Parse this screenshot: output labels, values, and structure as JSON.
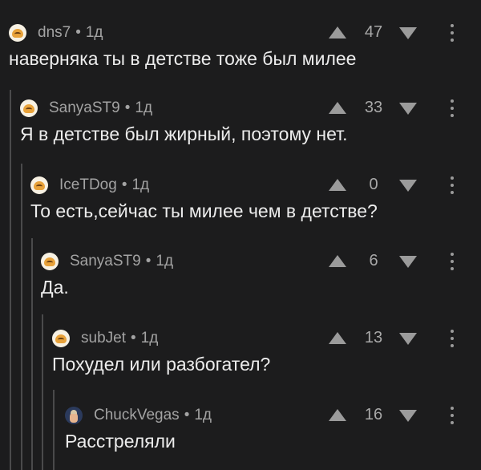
{
  "comments": [
    {
      "username": "dns7",
      "time": "1д",
      "score": "47",
      "text": "наверняка ты в детстве тоже был милее"
    },
    {
      "username": "SanyaST9",
      "time": "1д",
      "score": "33",
      "text": "Я в детстве был жирный, поэтому нет."
    },
    {
      "username": "IceTDog",
      "time": "1д",
      "score": "0",
      "text": "То есть,сейчас ты милее чем в детстве?"
    },
    {
      "username": "SanyaST9",
      "time": "1д",
      "score": "6",
      "text": "Да."
    },
    {
      "username": "subJet",
      "time": "1д",
      "score": "13",
      "text": "Похудел или разбогател?"
    },
    {
      "username": "ChuckVegas",
      "time": "1д",
      "score": "16",
      "text": "Расстреляли"
    }
  ],
  "separator": "•",
  "icons": {
    "upvote": "arrow-up-icon",
    "downvote": "arrow-down-icon",
    "more": "more-vertical-icon"
  },
  "colors": {
    "background": "#1c1c1d",
    "text": "#ececec",
    "muted": "#a3a3a3",
    "thread_line": "#4a4a4b"
  }
}
